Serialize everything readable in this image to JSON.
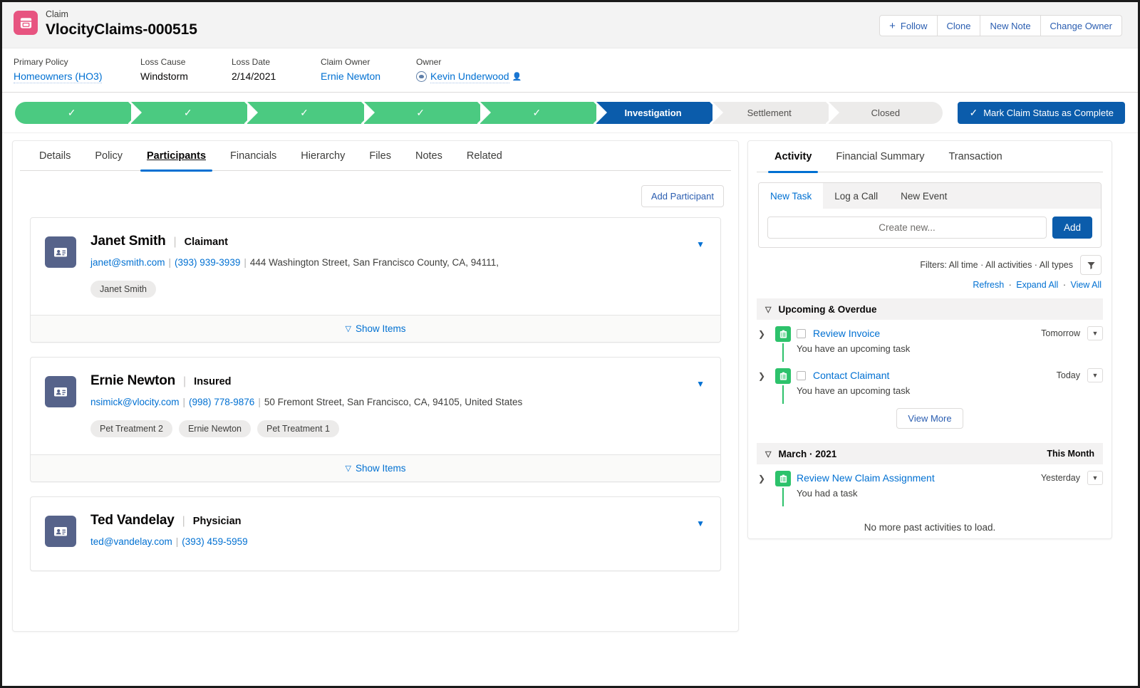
{
  "header": {
    "record_type": "Claim",
    "record_name": "VlocityClaims-000515",
    "icon": "claim-record-icon",
    "icon_color": "#e75480",
    "actions": [
      {
        "label": "Follow",
        "icon": "plus-icon"
      },
      {
        "label": "Clone"
      },
      {
        "label": "New Note"
      },
      {
        "label": "Change Owner"
      }
    ]
  },
  "highlights": [
    {
      "label": "Primary Policy",
      "value": "Homeowners (HO3)",
      "link": true
    },
    {
      "label": "Loss Cause",
      "value": "Windstorm",
      "link": false
    },
    {
      "label": "Loss Date",
      "value": "2/14/2021",
      "link": false
    },
    {
      "label": "Claim Owner",
      "value": "Ernie Newton",
      "link": true
    },
    {
      "label": "Owner",
      "value": "Kevin Underwood",
      "link": true,
      "avatar": true
    }
  ],
  "path": {
    "stages": [
      {
        "label": "",
        "state": "done"
      },
      {
        "label": "",
        "state": "done"
      },
      {
        "label": "",
        "state": "done"
      },
      {
        "label": "",
        "state": "done"
      },
      {
        "label": "",
        "state": "done"
      },
      {
        "label": "Investigation",
        "state": "current"
      },
      {
        "label": "Settlement",
        "state": "upcoming"
      },
      {
        "label": "Closed",
        "state": "upcoming"
      }
    ],
    "complete_button": "Mark Claim Status as Complete",
    "done_color": "#4bca81",
    "current_color": "#0b5cab",
    "upcoming_color": "#ecebea"
  },
  "main_tabs": [
    {
      "label": "Details",
      "active": false
    },
    {
      "label": "Policy",
      "active": false
    },
    {
      "label": "Participants",
      "active": true
    },
    {
      "label": "Financials",
      "active": false
    },
    {
      "label": "Hierarchy",
      "active": false
    },
    {
      "label": "Files",
      "active": false
    },
    {
      "label": "Notes",
      "active": false
    },
    {
      "label": "Related",
      "active": false
    }
  ],
  "participants_panel": {
    "add_button": "Add Participant",
    "show_items_label": "Show Items",
    "cards": [
      {
        "name": "Janet Smith",
        "role": "Claimant",
        "email": "janet@smith.com",
        "phone": "(393) 939-3939",
        "address": "444 Washington Street, San Francisco County, CA, 94111,",
        "tags": [
          "Janet Smith"
        ],
        "has_footer": true
      },
      {
        "name": "Ernie Newton",
        "role": "Insured",
        "email": "nsimick@vlocity.com",
        "phone": "(998) 778-9876",
        "address": "50 Fremont Street, San Francisco, CA, 94105, United States",
        "tags": [
          "Pet Treatment 2",
          "Ernie Newton",
          "Pet Treatment 1"
        ],
        "has_footer": true
      },
      {
        "name": "Ted Vandelay",
        "role": "Physician",
        "email": "ted@vandelay.com",
        "phone": "(393) 459-5959",
        "address": "",
        "tags": [],
        "has_footer": false
      }
    ]
  },
  "right_panel": {
    "tabs": [
      {
        "label": "Activity",
        "active": true
      },
      {
        "label": "Financial Summary",
        "active": false
      },
      {
        "label": "Transaction",
        "active": false
      }
    ],
    "composer": {
      "tabs": [
        {
          "label": "New Task",
          "active": true
        },
        {
          "label": "Log a Call",
          "active": false
        },
        {
          "label": "New Event",
          "active": false
        }
      ],
      "input_value": "",
      "input_placeholder": "Create new...",
      "add_label": "Add"
    },
    "filters_text": "Filters: All time · All activities · All types",
    "filter_icon": "funnel-icon",
    "links": [
      "Refresh",
      "Expand All",
      "View All"
    ],
    "sections": [
      {
        "title": "Upcoming & Overdue",
        "badge": "",
        "items": [
          {
            "title": "Review Invoice",
            "subtitle": "You have an upcoming task",
            "when": "Tomorrow",
            "has_checkbox": true,
            "icon": "task-icon"
          },
          {
            "title": "Contact Claimant",
            "subtitle": "You have an upcoming task",
            "when": "Today",
            "has_checkbox": true,
            "icon": "task-icon"
          }
        ],
        "view_more": "View More"
      },
      {
        "title": "March · 2021",
        "badge": "This Month",
        "items": [
          {
            "title": "Review New Claim Assignment",
            "subtitle": "You had a task",
            "when": "Yesterday",
            "has_checkbox": false,
            "icon": "task-icon"
          }
        ],
        "footer_note": "No more past activities to load."
      }
    ]
  }
}
